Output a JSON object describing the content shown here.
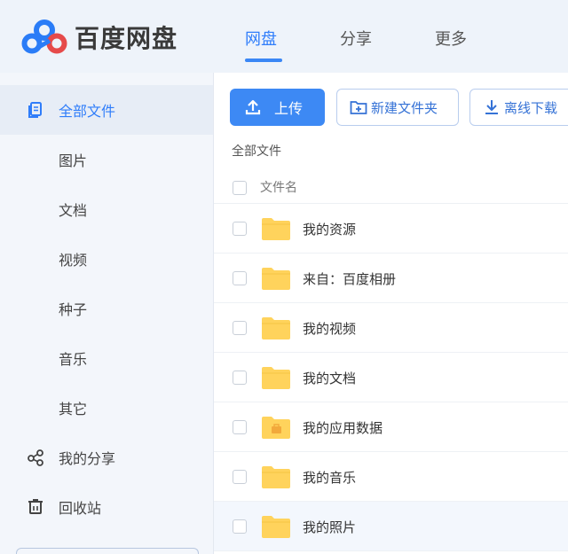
{
  "header": {
    "logo_text": "百度网盘",
    "tabs": [
      {
        "label": "网盘",
        "active": true
      },
      {
        "label": "分享",
        "active": false
      },
      {
        "label": "更多",
        "active": false
      }
    ]
  },
  "sidebar": {
    "items": [
      {
        "label": "全部文件",
        "icon": "files-icon",
        "active": true
      },
      {
        "label": "图片",
        "icon": "",
        "active": false
      },
      {
        "label": "文档",
        "icon": "",
        "active": false
      },
      {
        "label": "视频",
        "icon": "",
        "active": false
      },
      {
        "label": "种子",
        "icon": "",
        "active": false
      },
      {
        "label": "音乐",
        "icon": "",
        "active": false
      },
      {
        "label": "其它",
        "icon": "",
        "active": false
      },
      {
        "label": "我的分享",
        "icon": "share-icon",
        "active": false
      },
      {
        "label": "回收站",
        "icon": "trash-icon",
        "active": false
      }
    ]
  },
  "toolbar": {
    "upload_label": "上传",
    "new_folder_label": "新建文件夹",
    "offline_download_label": "离线下载"
  },
  "breadcrumb": "全部文件",
  "file_list": {
    "column_header": "文件名",
    "rows": [
      {
        "name": "我的资源",
        "icon": "folder-icon"
      },
      {
        "name": "来自：百度相册",
        "icon": "folder-icon"
      },
      {
        "name": "我的视频",
        "icon": "folder-icon"
      },
      {
        "name": "我的文档",
        "icon": "folder-icon"
      },
      {
        "name": "我的应用数据",
        "icon": "app-folder-icon"
      },
      {
        "name": "我的音乐",
        "icon": "folder-icon"
      },
      {
        "name": "我的照片",
        "icon": "folder-icon"
      }
    ]
  },
  "colors": {
    "accent": "#2f7dfa",
    "upload_button": "#3d89f4",
    "folder": "#ffd35c",
    "sidebar_active_bg": "#e7edf6"
  }
}
